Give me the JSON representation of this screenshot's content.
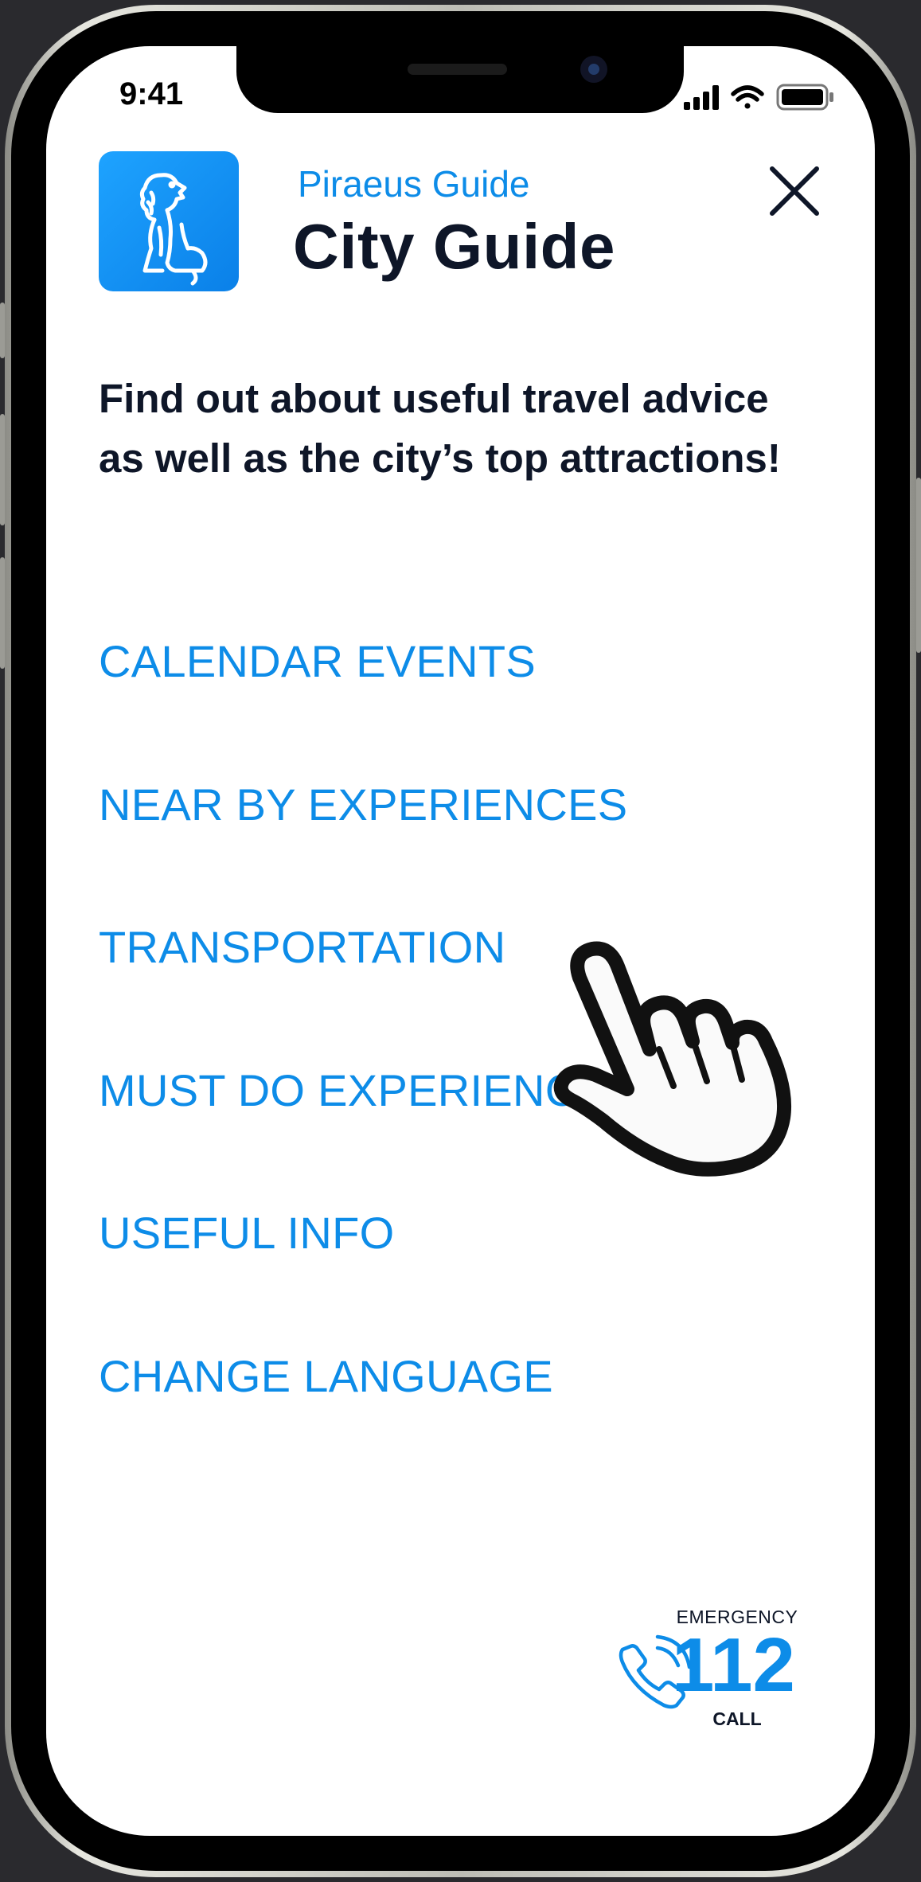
{
  "status_bar": {
    "time": "9:41"
  },
  "header": {
    "subtitle": "Piraeus Guide",
    "title": "City Guide",
    "logo_icon": "lion-icon",
    "close_icon": "close-icon"
  },
  "intro": {
    "text": "Find out about useful travel advice as well as the city’s top attractions!"
  },
  "menu": {
    "items": [
      {
        "label": "CALENDAR EVENTS"
      },
      {
        "label": "NEAR BY EXPERIENCES"
      },
      {
        "label": "TRANSPORTATION"
      },
      {
        "label": "MUST DO EXPERIENCES"
      },
      {
        "label": "USEFUL INFO"
      },
      {
        "label": "CHANGE LANGUAGE"
      }
    ]
  },
  "emergency": {
    "label": "EMERGENCY",
    "number": "112",
    "action": "CALL",
    "icon": "phone-icon"
  },
  "colors": {
    "accent": "#0d8ce8",
    "text": "#0e1628",
    "background": "#ffffff"
  }
}
